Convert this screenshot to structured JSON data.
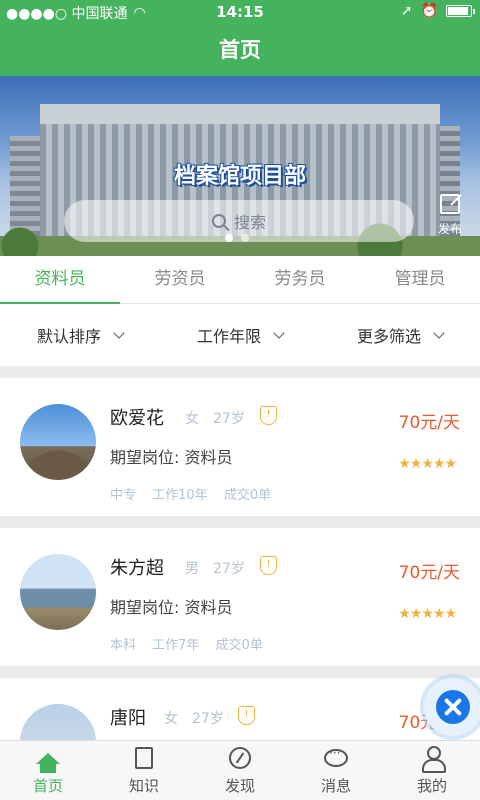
{
  "status_bar": {
    "carrier": "●●●●○ 中国联通",
    "time": "14:15"
  },
  "header": {
    "title": "首页"
  },
  "banner": {
    "title": "档案馆项目部",
    "search_placeholder": "搜索",
    "publish_label": "发布"
  },
  "tabs": [
    {
      "label": "资料员",
      "active": true
    },
    {
      "label": "劳资员",
      "active": false
    },
    {
      "label": "劳务员",
      "active": false
    },
    {
      "label": "管理员",
      "active": false
    }
  ],
  "filters": [
    {
      "label": "默认排序"
    },
    {
      "label": "工作年限"
    },
    {
      "label": "更多筛选"
    }
  ],
  "candidates": [
    {
      "name": "欧爱花",
      "gender": "女",
      "age": "27岁",
      "badge": "!",
      "price": "70元/天",
      "post": "期望岗位: 资料员",
      "rating_stars": "★★★★★",
      "rating": 5,
      "education": "中专",
      "experience": "工作10年",
      "deals": "成交0单"
    },
    {
      "name": "朱方超",
      "gender": "男",
      "age": "27岁",
      "badge": "!",
      "price": "70元/天",
      "post": "期望岗位: 资料员",
      "rating_stars": "★★★★★",
      "rating": 5,
      "education": "本科",
      "experience": "工作7年",
      "deals": "成交0单"
    },
    {
      "name": "唐阳",
      "gender": "女",
      "age": "27岁",
      "badge": "!",
      "price": "70元/天"
    }
  ],
  "bottom_nav": [
    {
      "label": "首页",
      "icon": "home-icon",
      "active": true
    },
    {
      "label": "知识",
      "icon": "book-icon",
      "active": false
    },
    {
      "label": "发现",
      "icon": "compass-icon",
      "active": false
    },
    {
      "label": "消息",
      "icon": "message-icon",
      "active": false
    },
    {
      "label": "我的",
      "icon": "user-icon",
      "active": false
    }
  ],
  "colors": {
    "primary": "#45b35d",
    "price": "#e85a2f",
    "star": "#f0b23e",
    "meta": "#b3c3d3"
  }
}
